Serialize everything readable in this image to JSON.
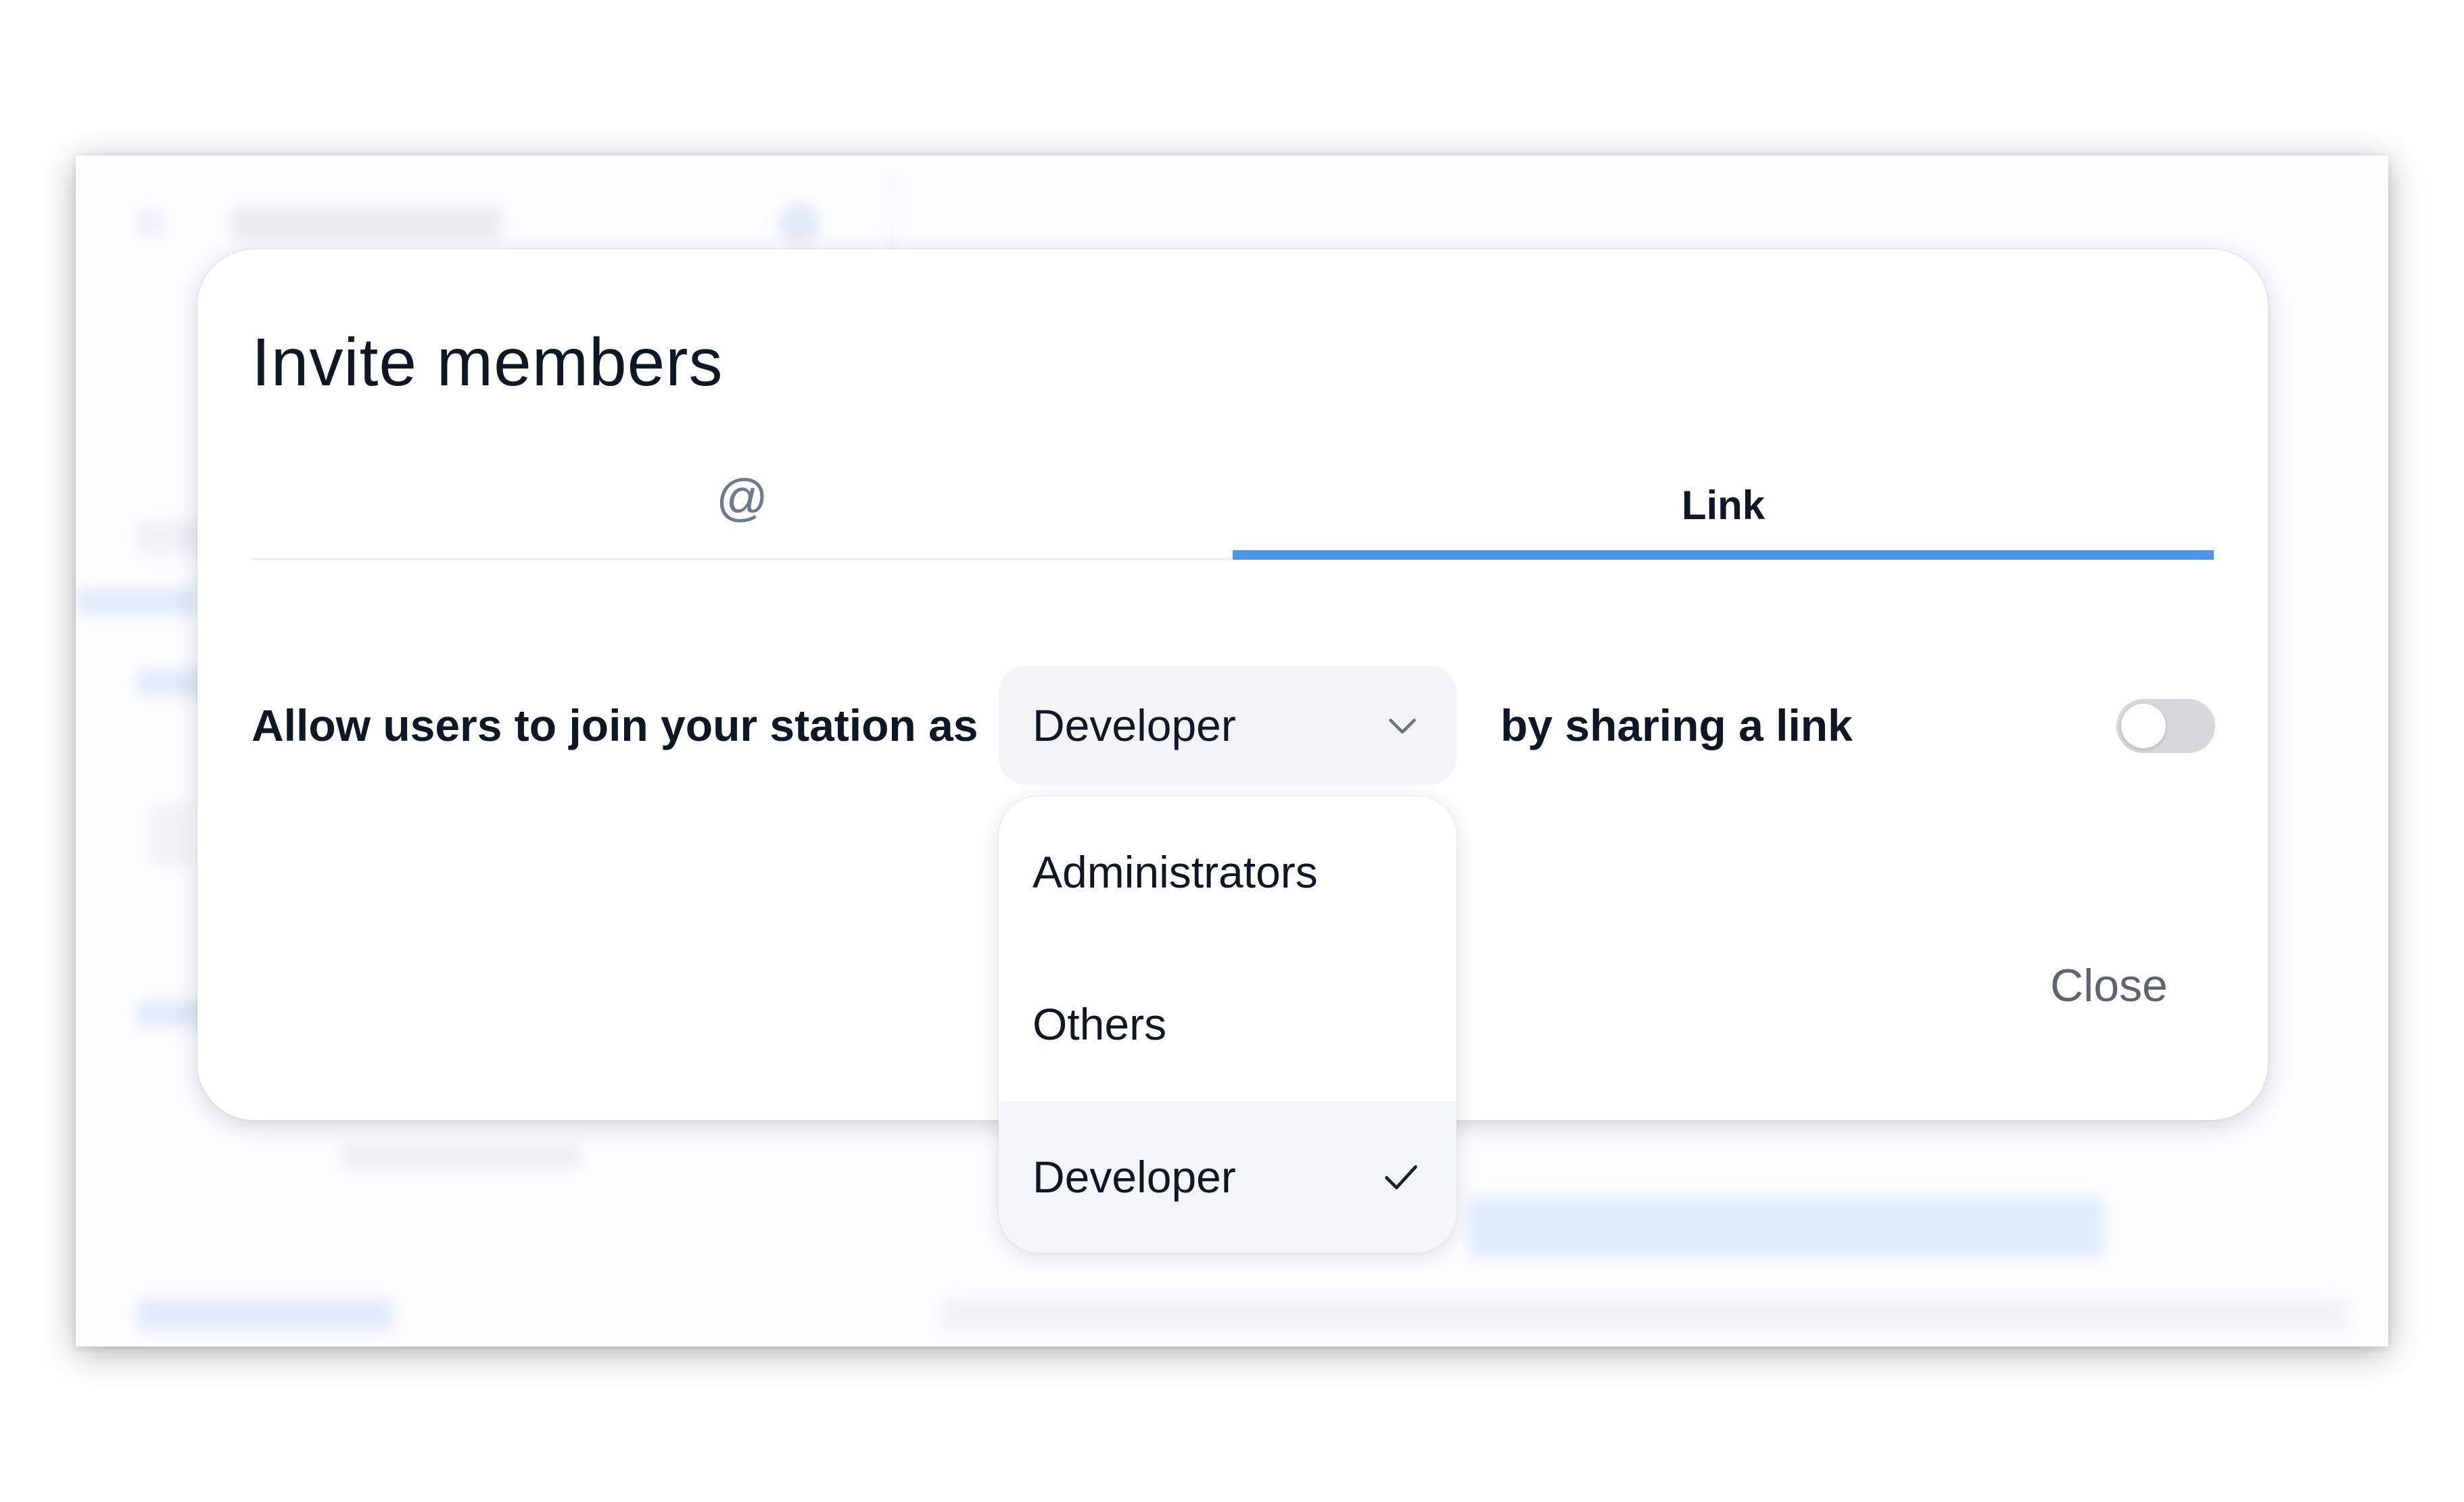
{
  "modal": {
    "title": "Invite members",
    "tabs": [
      {
        "id": "email",
        "label": "@",
        "icon": "at-icon",
        "active": false
      },
      {
        "id": "link",
        "label": "Link",
        "active": true
      }
    ],
    "row": {
      "prefix": "Allow users to join your station as",
      "selected_role": "Developer",
      "suffix": "by sharing a link",
      "toggle_on": false
    },
    "close_label": "Close"
  },
  "dropdown": {
    "options": [
      {
        "label": "Administrators",
        "selected": false
      },
      {
        "label": "Others",
        "selected": false
      },
      {
        "label": "Developer",
        "selected": true
      }
    ]
  },
  "colors": {
    "accent": "#4a97ea",
    "text": "#0d1726",
    "muted": "#5c6470"
  }
}
